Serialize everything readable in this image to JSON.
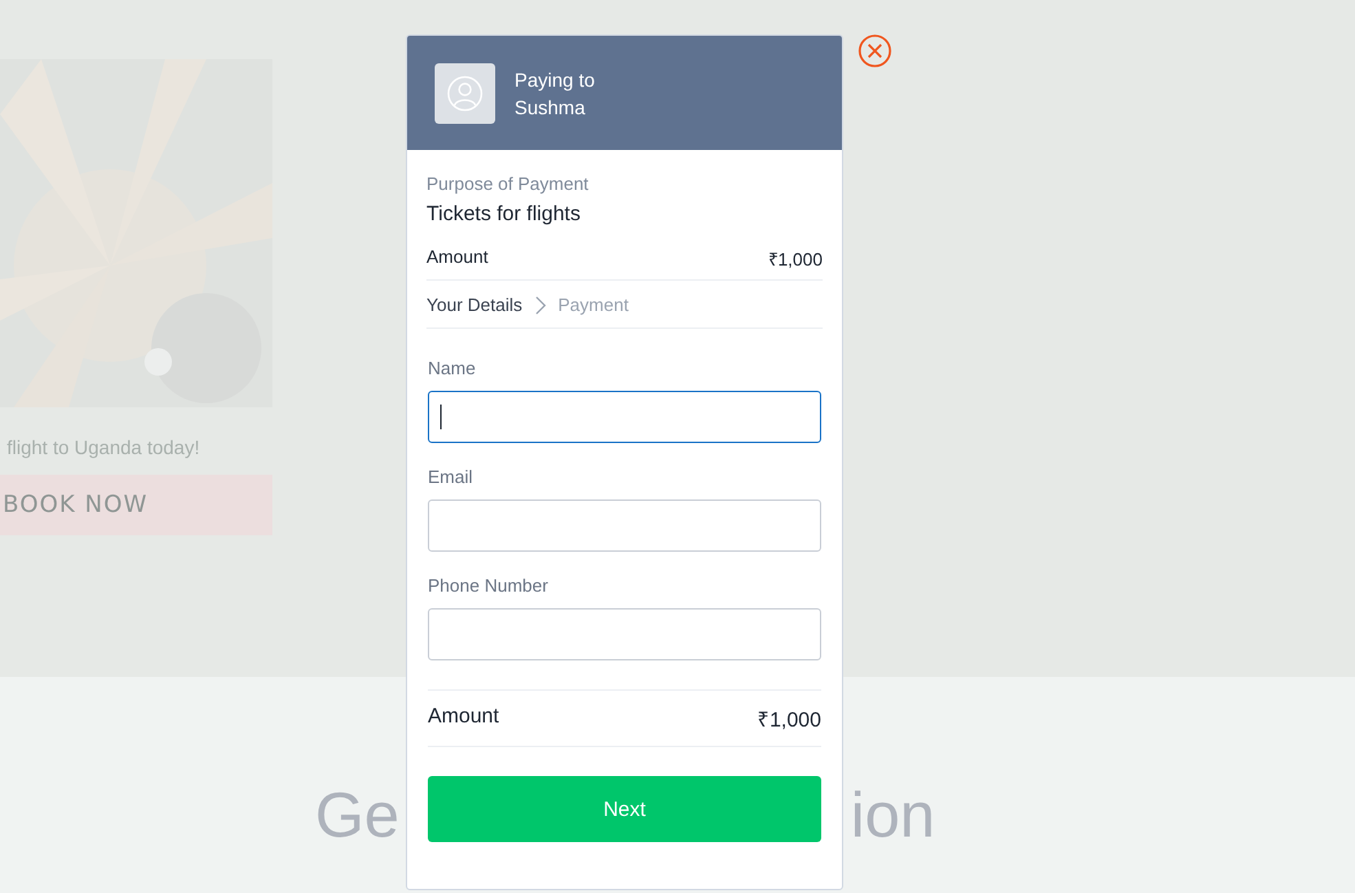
{
  "background": {
    "picture": {
      "kind": "picture"
    },
    "tagline": "flight to Uganda today!",
    "book_button": "BOOK NOW",
    "heading_parts": [
      "Ge",
      "ion"
    ]
  },
  "dialog": {
    "header": {
      "line1": "Paying to",
      "line2": "Sushma"
    },
    "purpose": {
      "label": "Purpose of Payment",
      "value": "Tickets for flights"
    },
    "amount": {
      "label": "Amount",
      "value": "₹1,000"
    },
    "steps": [
      {
        "label": "Your Details",
        "selected": true
      },
      {
        "label": "Payment",
        "selected": false
      }
    ],
    "fields": [
      {
        "label": "Name",
        "focused": true
      },
      {
        "label": "Email",
        "focused": false
      },
      {
        "label": "Phone Number",
        "focused": false
      }
    ],
    "total": {
      "label": "Amount",
      "value": "₹1,000"
    },
    "next_button": "Next"
  }
}
